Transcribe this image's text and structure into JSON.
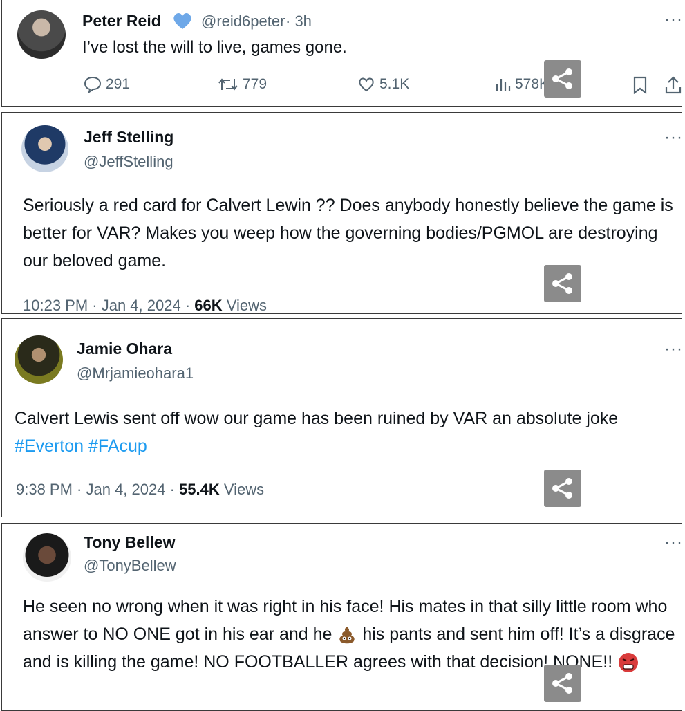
{
  "tweets": [
    {
      "name": "Peter Reid",
      "handle": "@reid6peter",
      "time": "· 3h",
      "text": "I’ve lost the will to live, games gone.",
      "replies": "291",
      "retweets": "779",
      "likes": "5.1K",
      "views": "578K"
    },
    {
      "name": "Jeff Stelling",
      "handle": "@JeffStelling",
      "text": "Seriously a red card for Calvert Lewin ?? Does anybody honestly believe the game is better for VAR? Makes you weep how the governing bodies/PGMOL are destroying our beloved game.",
      "date": "10:23 PM · Jan 4, 2024 · ",
      "views_count": "66K",
      "views_label": " Views"
    },
    {
      "name": "Jamie Ohara",
      "handle": "@Mrjamieohara1",
      "text": "Calvert Lewis sent off wow our game has been ruined by VAR an absolute joke ",
      "hashtag1": "#Everton",
      "hashtag2": "#FAcup",
      "date": "9:38 PM · Jan 4, 2024 · ",
      "views_count": "55.4K",
      "views_label": " Views"
    },
    {
      "name": "Tony Bellew",
      "handle": "@TonyBellew",
      "text_part1": "He seen no wrong when it was right in his face! His mates in that silly little room who answer to NO ONE got in his ear and he ",
      "text_part2": " his pants and sent him off! It’s a disgrace and is killing the game! NO FOOTBALLER agrees with that decision! NONE!! "
    }
  ],
  "more_label": "···",
  "colors": {
    "verified": "#6ea8e8",
    "hashtag": "#1d9bf0",
    "share_bg": "#8b8b8b"
  }
}
